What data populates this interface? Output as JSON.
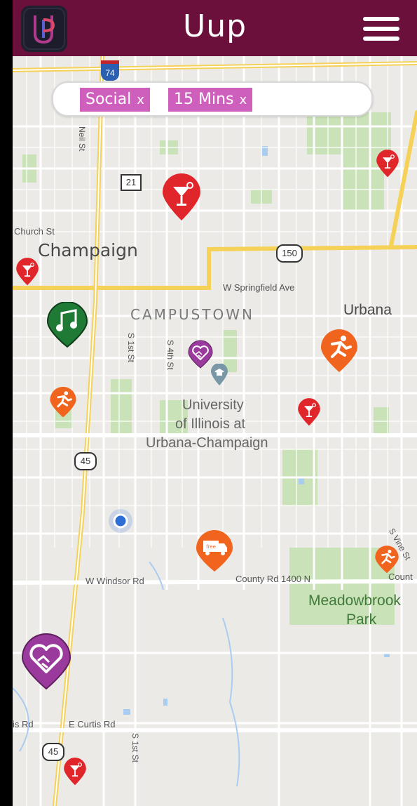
{
  "app": {
    "title": "Uup"
  },
  "filters": [
    {
      "label": "Social",
      "remove": "x"
    },
    {
      "label": "15 Mins",
      "remove": "x"
    }
  ],
  "map_labels": {
    "champaign": "Champaign",
    "campustown": "CAMPUSTOWN",
    "urbana": "Urbana",
    "university": [
      "University",
      "of Illinois at",
      "Urbana-Champaign"
    ],
    "meadowbrook": [
      "Meadowbrook",
      "Park"
    ],
    "church": "Church St",
    "springfield": "W Springfield Ave",
    "windsor": "W Windsor Rd",
    "county": "County Rd 1400 N",
    "curtis": "E Curtis Rd",
    "curtis_left": "is Rd",
    "neil": "Neil St",
    "s1st": "S 1st St",
    "s4th": "S 4th St",
    "s1st_bottom": "S 1st St",
    "svine": "S Vine St",
    "count": "Count",
    "shield_74": "74",
    "shield_21": "21",
    "shield_150": "150",
    "shield_45a": "45",
    "shield_45b": "45"
  },
  "colors": {
    "header": "#6b0f3b",
    "chip": "#cf5fbd",
    "drinks_pin": "#e0262b",
    "fitness_pin": "#f0641e",
    "music_pin": "#1f7a35",
    "social_pin": "#9a3a9c",
    "food_pin": "#f0641e",
    "location": "#2d6fd6"
  }
}
